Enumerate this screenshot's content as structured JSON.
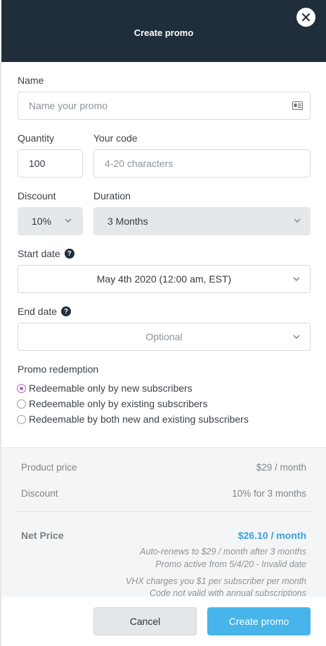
{
  "header": {
    "title": "Create promo",
    "close_icon": "close-icon"
  },
  "form": {
    "name": {
      "label": "Name",
      "placeholder": "Name your promo",
      "icon": "contact-card-icon"
    },
    "quantity": {
      "label": "Quantity",
      "value": "100"
    },
    "code": {
      "label": "Your code",
      "placeholder": "4-20 characters"
    },
    "discount": {
      "label": "Discount",
      "value": "10%"
    },
    "duration": {
      "label": "Duration",
      "value": "3 Months"
    },
    "start_date": {
      "label": "Start date",
      "value": "May 4th 2020 (12:00 am, EST)",
      "help": "?"
    },
    "end_date": {
      "label": "End date",
      "placeholder": "Optional",
      "help": "?"
    },
    "redemption": {
      "label": "Promo redemption",
      "options": [
        {
          "label": "Redeemable only by new subscribers",
          "selected": true
        },
        {
          "label": "Redeemable only by existing subscribers",
          "selected": false
        },
        {
          "label": "Redeemable by both new and existing subscribers",
          "selected": false
        }
      ]
    }
  },
  "summary": {
    "product_price_label": "Product price",
    "product_price_value": "$29 / month",
    "discount_label": "Discount",
    "discount_value": "10% for 3 months",
    "net_price_label": "Net Price",
    "net_price_value": "$26.10 / month",
    "notes": [
      "Auto-renews to $29 / month after 3 months",
      "Promo active from 5/4/20 - Invalid date",
      "VHX charges you $1 per subscriber per month",
      "Code not valid with annual subscriptions"
    ]
  },
  "footer": {
    "cancel_label": "Cancel",
    "create_label": "Create promo"
  },
  "colors": {
    "header_bg": "#1f2e3a",
    "primary_button": "#47b4ea",
    "net_price": "#3da1dc",
    "radio_selected": "#b063b5"
  }
}
